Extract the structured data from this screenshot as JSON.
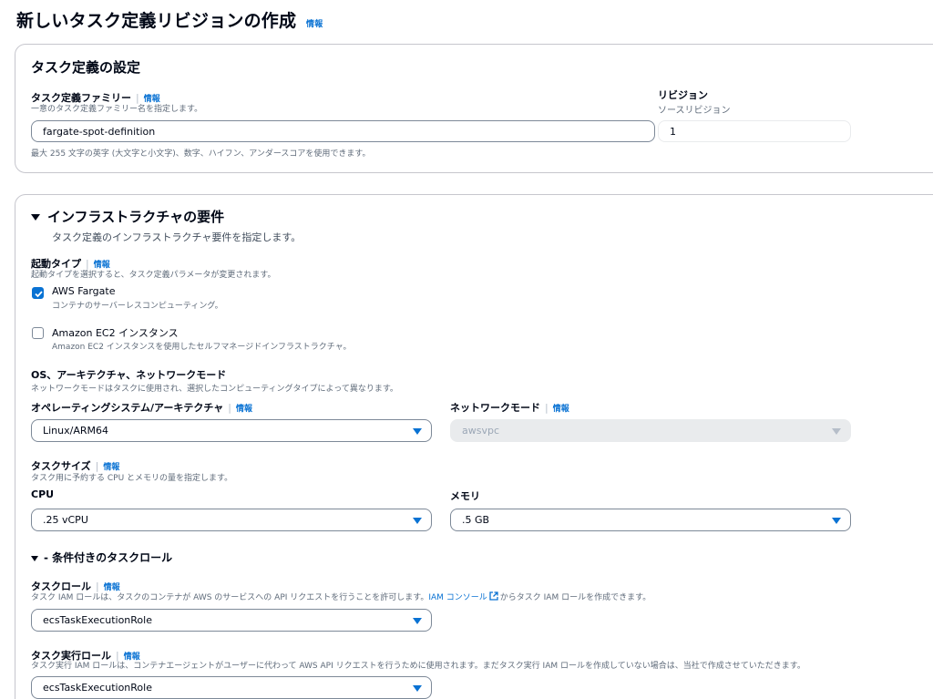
{
  "page": {
    "title": "新しいタスク定義リビジョンの作成",
    "info": "情報"
  },
  "task_def_settings": {
    "heading": "タスク定義の設定",
    "family_label": "タスク定義ファミリー",
    "family_info": "情報",
    "family_desc": "一意のタスク定義ファミリー名を指定します。",
    "family_value": "fargate-spot-definition",
    "family_hint": "最大 255 文字の英字 (大文字と小文字)、数字、ハイフン、アンダースコアを使用できます。",
    "revision_label": "リビジョン",
    "revision_desc": "ソースリビジョン",
    "revision_value": "1"
  },
  "infra": {
    "heading": "インフラストラクチャの要件",
    "desc": "タスク定義のインフラストラクチャ要件を指定します。",
    "launch_type_label": "起動タイプ",
    "launch_type_info": "情報",
    "launch_type_desc": "起動タイプを選択すると、タスク定義パラメータが変更されます。",
    "options": [
      {
        "label": "AWS Fargate",
        "desc": "コンテナのサーバーレスコンピューティング。",
        "checked": true
      },
      {
        "label": "Amazon EC2 インスタンス",
        "desc": "Amazon EC2 インスタンスを使用したセルフマネージドインフラストラクチャ。",
        "checked": false
      }
    ],
    "os_section_label": "OS、アーキテクチャ、ネットワークモード",
    "os_section_desc": "ネットワークモードはタスクに使用され、選択したコンピューティングタイプによって異なります。",
    "os_label": "オペレーティングシステム/アーキテクチャ",
    "os_info": "情報",
    "os_value": "Linux/ARM64",
    "network_label": "ネットワークモード",
    "network_info": "情報",
    "network_value": "awsvpc",
    "task_size_label": "タスクサイズ",
    "task_size_info": "情報",
    "task_size_desc": "タスク用に予約する CPU とメモリの量を指定します。",
    "cpu_label": "CPU",
    "cpu_value": ".25 vCPU",
    "memory_label": "メモリ",
    "memory_value": ".5 GB",
    "conditional_heading": "- 条件付きのタスクロール",
    "task_role_label": "タスクロール",
    "task_role_info": "情報",
    "task_role_desc_pre": "タスク IAM ロールは、タスクのコンテナが AWS のサービスへの API リクエストを行うことを許可します。",
    "task_role_link": "IAM コンソール",
    "task_role_desc_post": "からタスク IAM ロールを作成できます。",
    "task_role_value": "ecsTaskExecutionRole",
    "exec_role_label": "タスク実行ロール",
    "exec_role_info": "情報",
    "exec_role_desc": "タスク実行 IAM ロールは、コンテナエージェントがユーザーに代わって AWS API リクエストを行うために使用されます。まだタスク実行 IAM ロールを作成していない場合は、当社で作成させていただきます。",
    "exec_role_value": "ecsTaskExecutionRole"
  }
}
